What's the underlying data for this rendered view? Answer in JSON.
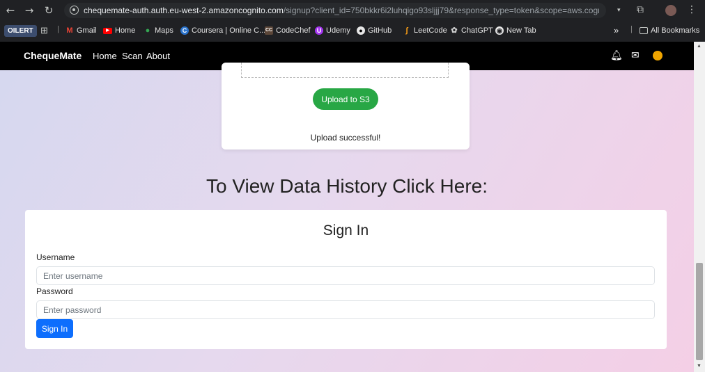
{
  "browser": {
    "url_host": "chequemate-auth.auth.eu-west-2.amazoncognito.com",
    "url_path": "/signup?client_id=750bkkr6i2luhqigo93sljjj79&response_type=token&scope=aws.cognito.sig...",
    "bookmarks": [
      {
        "label": "OILERT",
        "icon": "oilert-badge"
      },
      {
        "label": "",
        "icon": "apps-grid-icon"
      },
      {
        "label": "Gmail",
        "icon": "gmail-icon"
      },
      {
        "label": "Home",
        "icon": "youtube-icon"
      },
      {
        "label": "Maps",
        "icon": "maps-icon"
      },
      {
        "label": "Coursera | Online C...",
        "icon": "coursera-icon"
      },
      {
        "label": "CodeChef",
        "icon": "codechef-icon"
      },
      {
        "label": "Udemy",
        "icon": "udemy-icon"
      },
      {
        "label": "GitHub",
        "icon": "github-icon"
      },
      {
        "label": "LeetCode",
        "icon": "leetcode-icon"
      },
      {
        "label": "ChatGPT",
        "icon": "chatgpt-icon"
      },
      {
        "label": "New Tab",
        "icon": "newtab-icon"
      }
    ],
    "more_label": "»",
    "all_bookmarks_label": "All Bookmarks"
  },
  "navbar": {
    "brand": "ChequeMate",
    "links": [
      "Home",
      "Scan",
      "About"
    ],
    "icons": [
      "bell-icon",
      "envelope-icon",
      "user-circle-icon"
    ],
    "icon_colors": {
      "bell": "#ffffff",
      "envelope": "#ffffff",
      "user": "#f0a500"
    }
  },
  "upload": {
    "button_label": "Upload to S3",
    "status": "Upload successful!"
  },
  "history_heading": "To View Data History Click Here:",
  "signin": {
    "title": "Sign In",
    "username_label": "Username",
    "username_placeholder": "Enter username",
    "password_label": "Password",
    "password_placeholder": "Enter password",
    "button_label": "Sign In"
  },
  "colors": {
    "navbar_bg": "#000000",
    "upload_button": "#28a745",
    "signin_button": "#0d6efd"
  }
}
